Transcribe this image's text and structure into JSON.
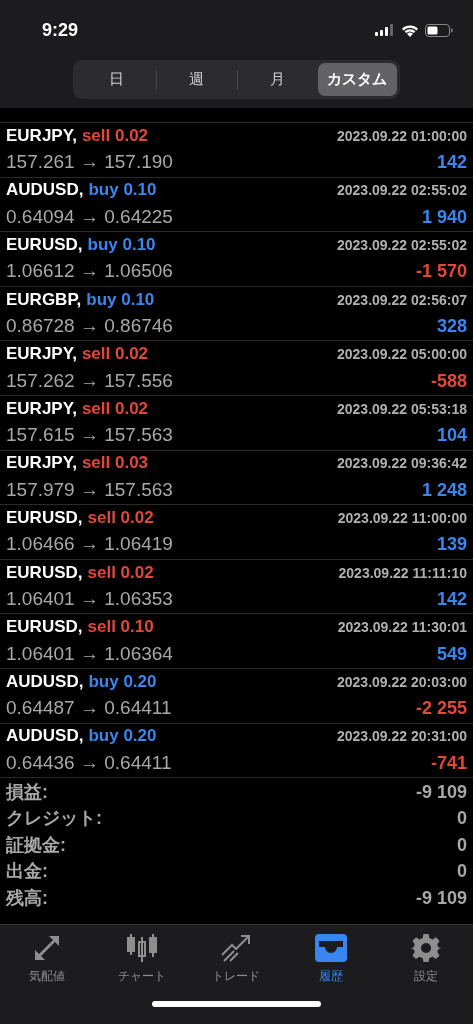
{
  "status_bar": {
    "time": "9:29"
  },
  "period_tabs": [
    {
      "label": "日",
      "selected": false
    },
    {
      "label": "週",
      "selected": false
    },
    {
      "label": "月",
      "selected": false
    },
    {
      "label": "カスタム",
      "selected": true
    }
  ],
  "deals": [
    {
      "symbol": "EURJPY,",
      "kind": "sell",
      "side": "sell 0.02",
      "time": "2023.09.22 01:00:00",
      "prices": "157.261 → 157.190",
      "profit": "142",
      "loss": false
    },
    {
      "symbol": "AUDUSD,",
      "kind": "buy",
      "side": "buy 0.10",
      "time": "2023.09.22 02:55:02",
      "prices": "0.64094 → 0.64225",
      "profit": "1 940",
      "loss": false
    },
    {
      "symbol": "EURUSD,",
      "kind": "buy",
      "side": "buy 0.10",
      "time": "2023.09.22 02:55:02",
      "prices": "1.06612 → 1.06506",
      "profit": "-1 570",
      "loss": true
    },
    {
      "symbol": "EURGBP,",
      "kind": "buy",
      "side": "buy 0.10",
      "time": "2023.09.22 02:56:07",
      "prices": "0.86728 → 0.86746",
      "profit": "328",
      "loss": false
    },
    {
      "symbol": "EURJPY,",
      "kind": "sell",
      "side": "sell 0.02",
      "time": "2023.09.22 05:00:00",
      "prices": "157.262 → 157.556",
      "profit": "-588",
      "loss": true
    },
    {
      "symbol": "EURJPY,",
      "kind": "sell",
      "side": "sell 0.02",
      "time": "2023.09.22 05:53:18",
      "prices": "157.615 → 157.563",
      "profit": "104",
      "loss": false
    },
    {
      "symbol": "EURJPY,",
      "kind": "sell",
      "side": "sell 0.03",
      "time": "2023.09.22 09:36:42",
      "prices": "157.979 → 157.563",
      "profit": "1 248",
      "loss": false
    },
    {
      "symbol": "EURUSD,",
      "kind": "sell",
      "side": "sell 0.02",
      "time": "2023.09.22 11:00:00",
      "prices": "1.06466 → 1.06419",
      "profit": "139",
      "loss": false
    },
    {
      "symbol": "EURUSD,",
      "kind": "sell",
      "side": "sell 0.02",
      "time": "2023.09.22 11:11:10",
      "prices": "1.06401 → 1.06353",
      "profit": "142",
      "loss": false
    },
    {
      "symbol": "EURUSD,",
      "kind": "sell",
      "side": "sell 0.10",
      "time": "2023.09.22 11:30:01",
      "prices": "1.06401 → 1.06364",
      "profit": "549",
      "loss": false
    },
    {
      "symbol": "AUDUSD,",
      "kind": "buy",
      "side": "buy 0.20",
      "time": "2023.09.22 20:03:00",
      "prices": "0.64487 → 0.64411",
      "profit": "-2 255",
      "loss": true
    },
    {
      "symbol": "AUDUSD,",
      "kind": "buy",
      "side": "buy 0.20",
      "time": "2023.09.22 20:31:00",
      "prices": "0.64436 → 0.64411",
      "profit": "-741",
      "loss": true
    }
  ],
  "summary": [
    {
      "label": "損益:",
      "value": "-9 109"
    },
    {
      "label": "クレジット:",
      "value": "0"
    },
    {
      "label": "証拠金:",
      "value": "0"
    },
    {
      "label": "出金:",
      "value": "0"
    },
    {
      "label": "残高:",
      "value": "-9 109"
    }
  ],
  "tab_bar": [
    {
      "kind": "quotes",
      "label": "気配値",
      "selected": false
    },
    {
      "kind": "chart",
      "label": "チャート",
      "selected": false
    },
    {
      "kind": "trade",
      "label": "トレード",
      "selected": false
    },
    {
      "kind": "history",
      "label": "履歴",
      "selected": true
    },
    {
      "kind": "settings",
      "label": "設定",
      "selected": false
    }
  ]
}
